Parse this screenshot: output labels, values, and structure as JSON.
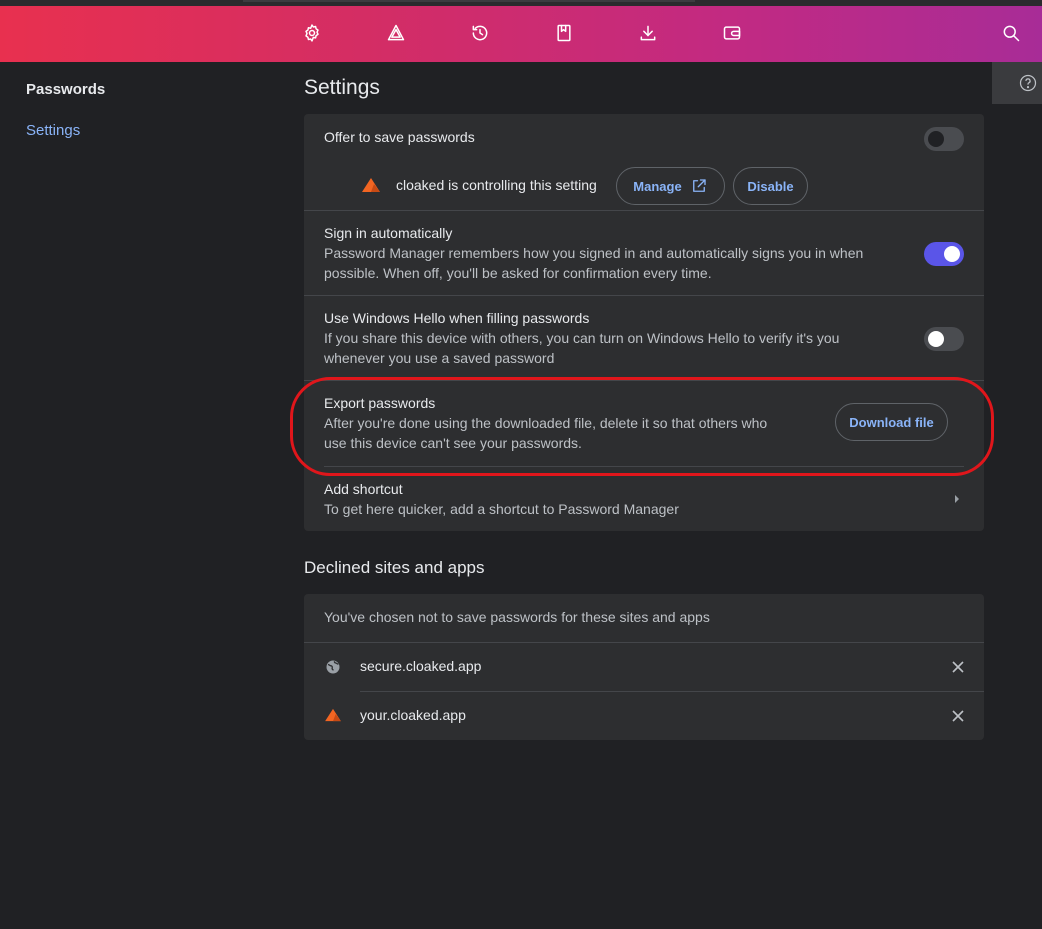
{
  "toolbar": {
    "icons": [
      "gear-icon",
      "triangle-icon",
      "history-icon",
      "bookmark-icon",
      "download-icon",
      "wallet-icon",
      "search-icon"
    ]
  },
  "sidebar": {
    "items": [
      {
        "label": "Passwords"
      },
      {
        "label": "Settings"
      }
    ]
  },
  "main": {
    "title": "Settings",
    "settings": {
      "offer_save": {
        "title": "Offer to save passwords",
        "enabled": false,
        "controller_text": "cloaked is controlling this setting",
        "manage_label": "Manage",
        "disable_label": "Disable"
      },
      "sign_in_auto": {
        "title": "Sign in automatically",
        "desc_line1": "Password Manager remembers how you signed in and automatically signs you in when",
        "desc_line2": "possible. When off, you'll be asked for confirmation every time.",
        "enabled": true
      },
      "windows_hello": {
        "title": "Use Windows Hello when filling passwords",
        "desc_line1": "If you share this device with others, you can turn on Windows Hello to verify it's you",
        "desc_line2": "whenever you use a saved password",
        "enabled": false
      },
      "export": {
        "title": "Export passwords",
        "desc_line1": "After you're done using the downloaded file, delete it so that others who",
        "desc_line2": "use this device can't see your passwords.",
        "button_label": "Download file"
      },
      "shortcut": {
        "title": "Add shortcut",
        "desc": "To get here quicker, add a shortcut to Password Manager"
      }
    },
    "declined": {
      "title": "Declined sites and apps",
      "intro": "You've chosen not to save passwords for these sites and apps",
      "sites": [
        {
          "name": "secure.cloaked.app",
          "icon": "globe-icon"
        },
        {
          "name": "your.cloaked.app",
          "icon": "cloaked-logo-icon"
        }
      ]
    }
  },
  "colors": {
    "accent": "#8ab4f8",
    "toggle_on": "#5a55e8",
    "highlight": "#e0161b",
    "cloaked_orange": "#f26522"
  }
}
